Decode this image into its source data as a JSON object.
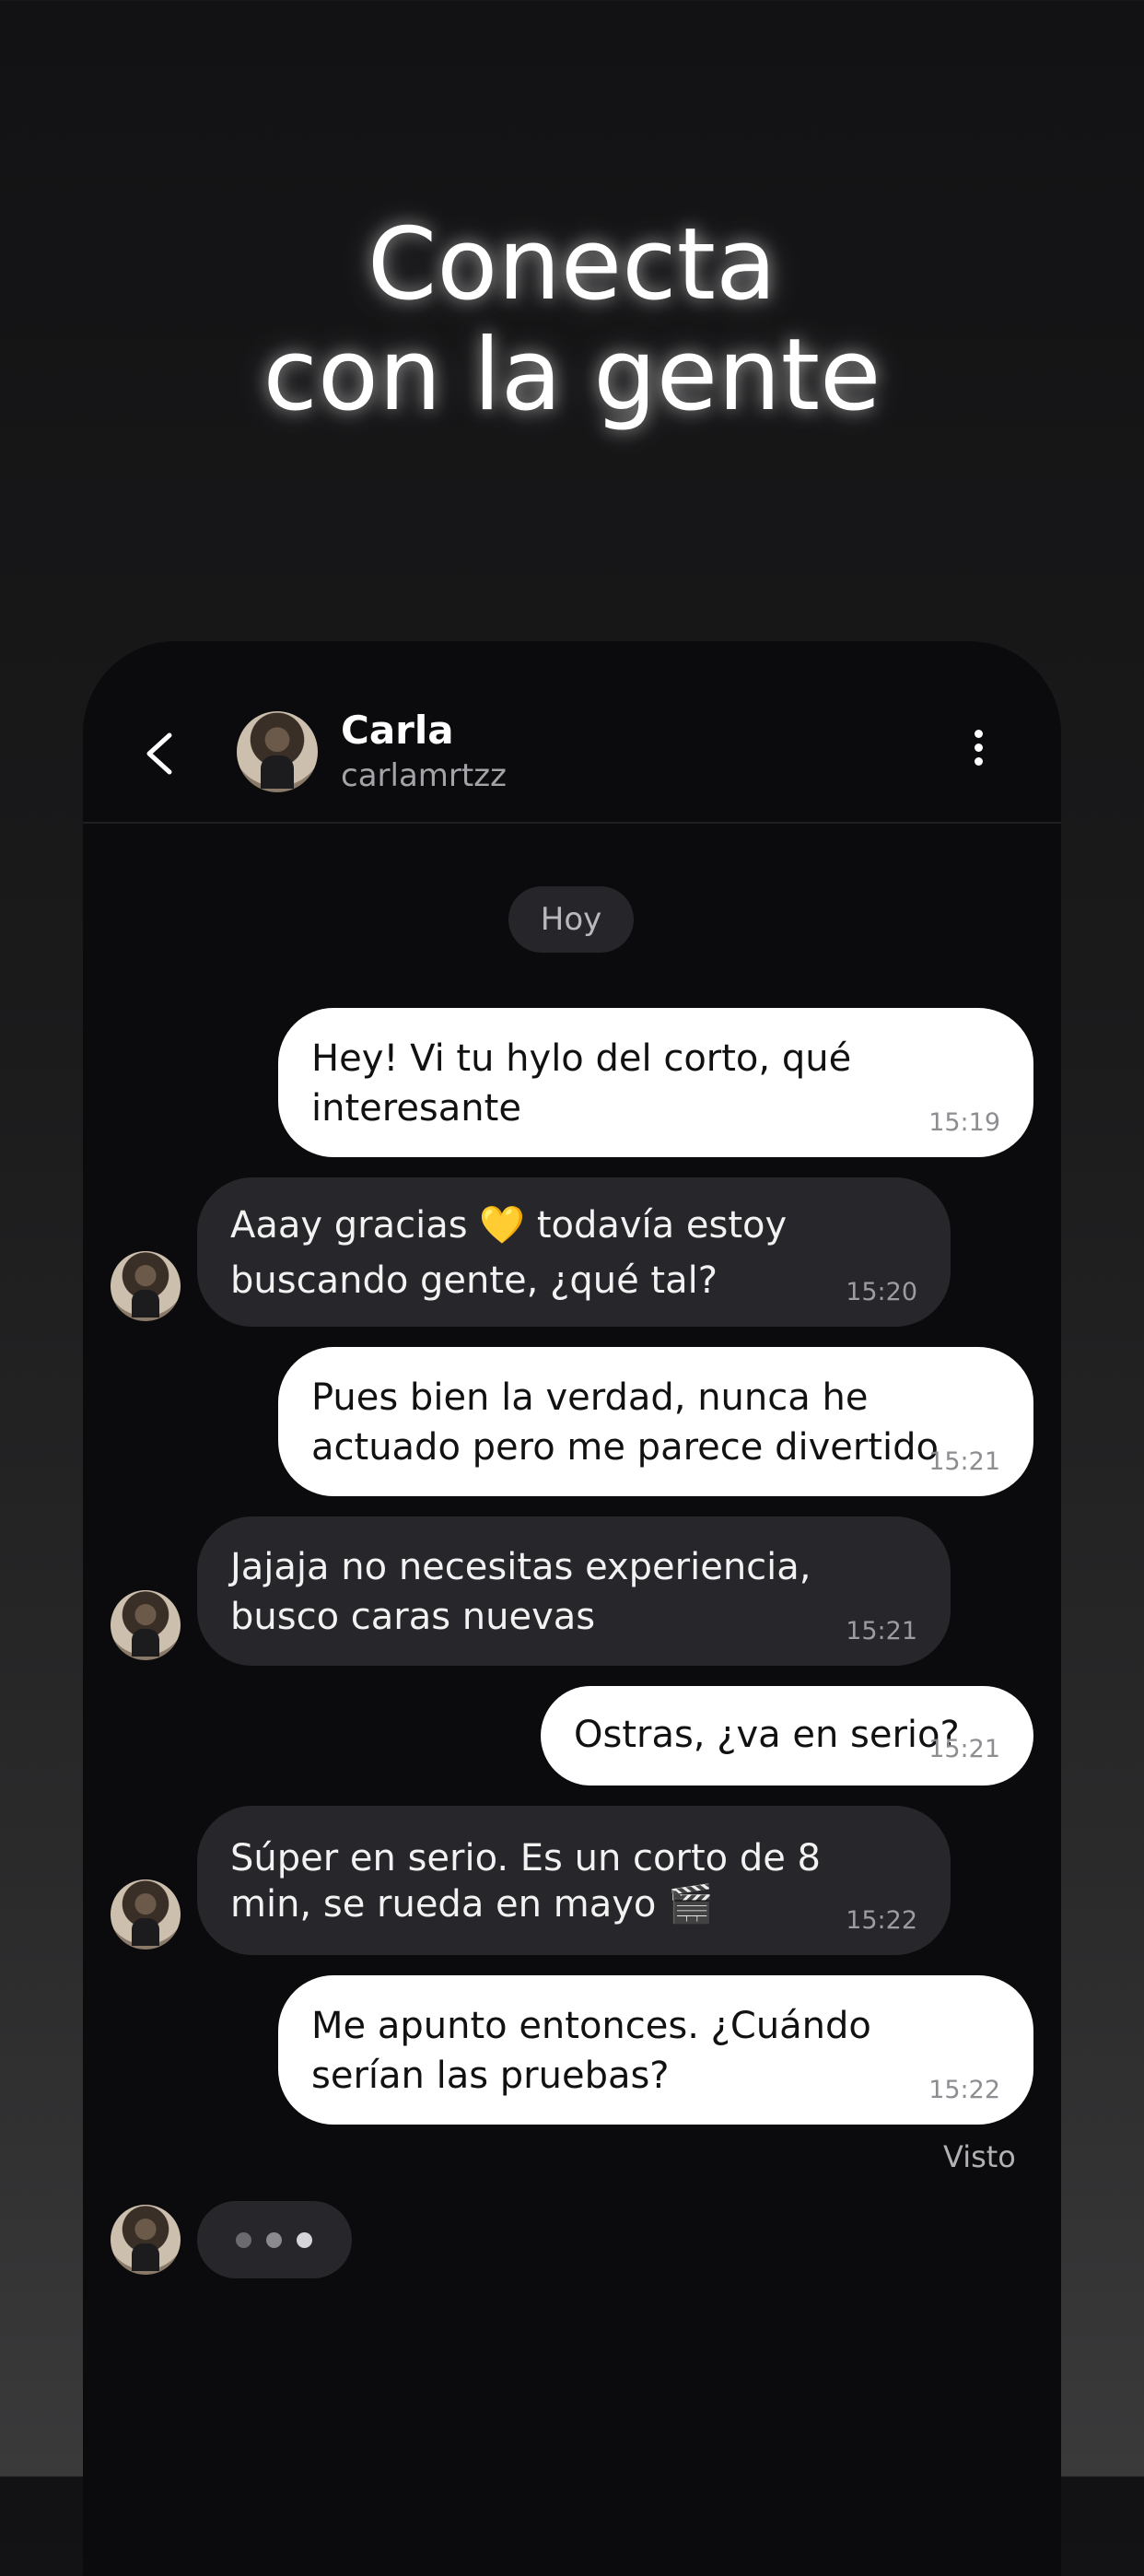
{
  "headline": {
    "line1": "Conecta",
    "line2": "con la gente"
  },
  "chat_header": {
    "name": "Carla",
    "handle": "carlamrtzz",
    "icons": {
      "back": "chevron-left-icon",
      "more": "more-vertical-icon"
    }
  },
  "day_label": "Hoy",
  "messages": [
    {
      "from": "me",
      "text": "Hey! Vi tu hylo del corto, qué interesante",
      "time": "15:19"
    },
    {
      "from": "Carla",
      "text": "Aaay gracias 💛 todavía estoy buscando gente, ¿qué tal?",
      "time": "15:20"
    },
    {
      "from": "me",
      "text": "Pues bien la verdad, nunca he actuado pero me parece divertido",
      "time": "15:21"
    },
    {
      "from": "Carla",
      "text": "Jajaja no necesitas experiencia, busco caras nuevas",
      "time": "15:21"
    },
    {
      "from": "me",
      "text": "Ostras, ¿va en serio?",
      "time": "15:21"
    },
    {
      "from": "Carla",
      "text": "Súper en serio. Es un corto de 8 min, se rueda en mayo 🎬",
      "time": "15:22"
    },
    {
      "from": "me",
      "text": "Me apunto entonces. ¿Cuándo serían las pruebas?",
      "time": "15:22"
    }
  ],
  "seen_label": "Visto",
  "colors": {
    "outgoing_bubble": "#ffffff",
    "incoming_bubble": "#27272b",
    "chat_background": "#0b0b0e"
  }
}
